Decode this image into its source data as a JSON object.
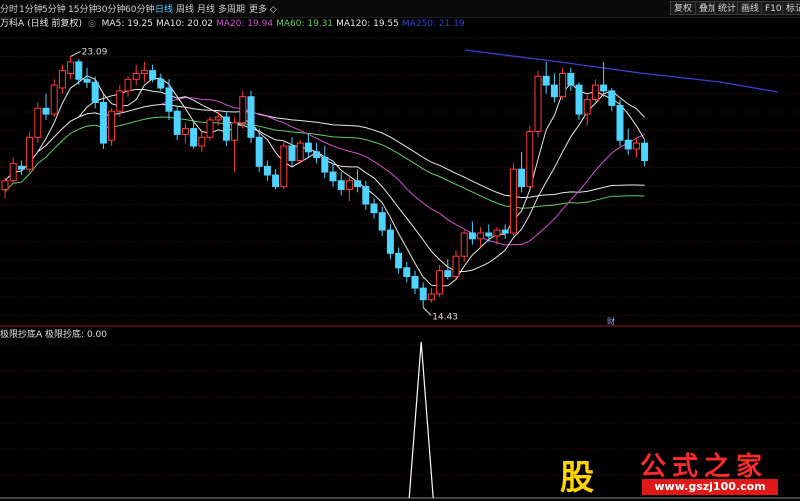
{
  "toolbar": {
    "tabs": [
      {
        "label": "分时",
        "x": 0
      },
      {
        "label": "1分钟",
        "x": 19
      },
      {
        "label": "5分钟",
        "x": 42
      },
      {
        "label": "15分钟",
        "x": 68
      },
      {
        "label": "30分钟",
        "x": 96
      },
      {
        "label": "60分钟",
        "x": 125
      },
      {
        "label": "日线",
        "x": 155,
        "active": true
      },
      {
        "label": "周线",
        "x": 176
      },
      {
        "label": "月线",
        "x": 197
      },
      {
        "label": "多周期",
        "x": 218
      },
      {
        "label": "更多",
        "x": 249
      }
    ],
    "buttons": [
      {
        "label": "复权",
        "x": 670
      },
      {
        "label": "叠加",
        "x": 695
      },
      {
        "label": "统计",
        "x": 714
      },
      {
        "label": "画线",
        "x": 737
      },
      {
        "label": "F10",
        "x": 761
      },
      {
        "label": "标记",
        "x": 782
      }
    ]
  },
  "legend": {
    "stock": "万科A",
    "mode": "(日线 前复权)",
    "items": [
      {
        "label": "MA5: 19.25",
        "color": "#e8e8e8"
      },
      {
        "label": "MA10: 20.02",
        "color": "#e8e8e8"
      },
      {
        "label": "MA20: 19.94",
        "color": "#d050d0"
      },
      {
        "label": "MA60: 19.31",
        "color": "#60d060"
      },
      {
        "label": "MA120: 19.55",
        "color": "#e8e8e8"
      },
      {
        "label": "MA250: 21.19",
        "color": "#3a40d0"
      }
    ]
  },
  "sublegend": {
    "title": "极限抄底A",
    "items": [
      {
        "label": "极限抄底: 0.00",
        "color": "#e0e0e0"
      }
    ]
  },
  "annotations": {
    "high": "23.09",
    "low": "14.43",
    "marker": "财"
  },
  "watermark": {
    "logo": "股",
    "name": "公式之家",
    "url": "www.gszj100.com"
  },
  "chart_data": {
    "type": "candlestick",
    "ylim": [
      14.0,
      24.0
    ],
    "candles": [
      [
        18.5,
        18.9,
        18.2,
        18.8
      ],
      [
        18.8,
        19.6,
        18.7,
        19.4
      ],
      [
        19.3,
        19.5,
        19.0,
        19.2
      ],
      [
        19.2,
        20.5,
        19.1,
        20.3
      ],
      [
        20.3,
        21.5,
        20.1,
        21.3
      ],
      [
        21.3,
        21.8,
        20.9,
        21.1
      ],
      [
        21.1,
        22.3,
        21.0,
        22.1
      ],
      [
        22.0,
        22.8,
        21.8,
        22.6
      ],
      [
        22.5,
        23.09,
        22.3,
        22.9
      ],
      [
        22.9,
        23.0,
        22.1,
        22.3
      ],
      [
        22.3,
        22.7,
        22.0,
        22.2
      ],
      [
        22.2,
        22.4,
        21.3,
        21.5
      ],
      [
        21.5,
        21.8,
        19.9,
        20.1
      ],
      [
        20.2,
        21.3,
        20.0,
        21.2
      ],
      [
        21.2,
        22.1,
        21.0,
        21.9
      ],
      [
        21.9,
        22.4,
        21.7,
        22.3
      ],
      [
        22.3,
        22.8,
        22.1,
        22.5
      ],
      [
        22.5,
        22.9,
        22.2,
        22.6
      ],
      [
        22.6,
        22.8,
        22.2,
        22.3
      ],
      [
        22.3,
        22.5,
        21.9,
        22.0
      ],
      [
        22.0,
        22.3,
        20.9,
        21.2
      ],
      [
        21.2,
        21.4,
        20.2,
        20.4
      ],
      [
        20.4,
        20.8,
        20.1,
        20.6
      ],
      [
        20.6,
        20.9,
        19.9,
        20.0
      ],
      [
        20.0,
        20.5,
        19.8,
        20.3
      ],
      [
        20.3,
        21.0,
        20.2,
        20.9
      ],
      [
        20.9,
        21.2,
        20.7,
        21.0
      ],
      [
        21.0,
        21.2,
        20.0,
        20.2
      ],
      [
        20.2,
        21.0,
        19.1,
        20.8
      ],
      [
        20.8,
        21.9,
        20.6,
        21.7
      ],
      [
        21.7,
        21.9,
        20.1,
        20.3
      ],
      [
        20.3,
        20.6,
        19.1,
        19.3
      ],
      [
        19.3,
        19.5,
        18.8,
        19.0
      ],
      [
        19.0,
        19.2,
        18.5,
        18.6
      ],
      [
        18.6,
        20.2,
        18.5,
        20.0
      ],
      [
        20.0,
        20.3,
        19.3,
        19.5
      ],
      [
        19.5,
        20.2,
        19.4,
        20.1
      ],
      [
        20.1,
        20.4,
        19.6,
        19.8
      ],
      [
        19.8,
        20.1,
        19.4,
        19.6
      ],
      [
        19.6,
        20.0,
        18.9,
        19.1
      ],
      [
        19.1,
        19.4,
        18.6,
        18.8
      ],
      [
        18.8,
        19.1,
        18.3,
        18.5
      ],
      [
        18.5,
        19.0,
        18.1,
        18.8
      ],
      [
        18.8,
        19.2,
        18.4,
        18.6
      ],
      [
        18.6,
        18.8,
        17.8,
        18.0
      ],
      [
        18.0,
        18.2,
        17.5,
        17.7
      ],
      [
        17.7,
        17.9,
        16.9,
        17.1
      ],
      [
        17.1,
        17.3,
        16.1,
        16.3
      ],
      [
        16.3,
        16.5,
        15.6,
        15.8
      ],
      [
        15.8,
        16.0,
        15.3,
        15.5
      ],
      [
        15.5,
        15.7,
        14.9,
        15.1
      ],
      [
        15.1,
        15.3,
        14.43,
        14.7
      ],
      [
        14.7,
        15.1,
        14.6,
        14.9
      ],
      [
        14.9,
        15.9,
        14.8,
        15.7
      ],
      [
        15.7,
        16.1,
        15.4,
        15.5
      ],
      [
        15.5,
        16.4,
        15.4,
        16.2
      ],
      [
        16.2,
        17.1,
        16.0,
        17.0
      ],
      [
        17.0,
        17.4,
        16.6,
        16.8
      ],
      [
        16.8,
        17.2,
        16.5,
        17.0
      ],
      [
        17.0,
        17.3,
        16.7,
        16.9
      ],
      [
        16.9,
        17.2,
        16.6,
        17.1
      ],
      [
        17.1,
        17.3,
        16.8,
        17.0
      ],
      [
        17.0,
        19.4,
        16.9,
        19.2
      ],
      [
        19.2,
        19.8,
        18.4,
        18.6
      ],
      [
        18.6,
        20.7,
        18.5,
        20.5
      ],
      [
        20.5,
        22.6,
        20.3,
        22.4
      ],
      [
        22.4,
        22.9,
        21.8,
        22.1
      ],
      [
        22.1,
        22.5,
        21.5,
        21.7
      ],
      [
        21.7,
        22.7,
        21.6,
        22.5
      ],
      [
        22.5,
        22.7,
        21.9,
        22.1
      ],
      [
        22.1,
        22.2,
        20.9,
        21.1
      ],
      [
        21.1,
        21.8,
        20.7,
        21.6
      ],
      [
        21.6,
        22.3,
        21.5,
        22.1
      ],
      [
        22.1,
        22.9,
        21.7,
        21.9
      ],
      [
        21.9,
        22.0,
        21.2,
        21.4
      ],
      [
        21.4,
        21.6,
        20.0,
        20.2
      ],
      [
        20.2,
        20.6,
        19.7,
        19.9
      ],
      [
        19.9,
        20.3,
        19.6,
        20.1
      ],
      [
        20.1,
        20.2,
        19.3,
        19.5
      ]
    ],
    "indicator": {
      "name": "极限抄底",
      "value": 0.0,
      "spike_index": 51,
      "spike_value": 1.0
    },
    "ma_lines": [
      "MA5",
      "MA10",
      "MA20",
      "MA60",
      "MA120",
      "MA250"
    ]
  }
}
